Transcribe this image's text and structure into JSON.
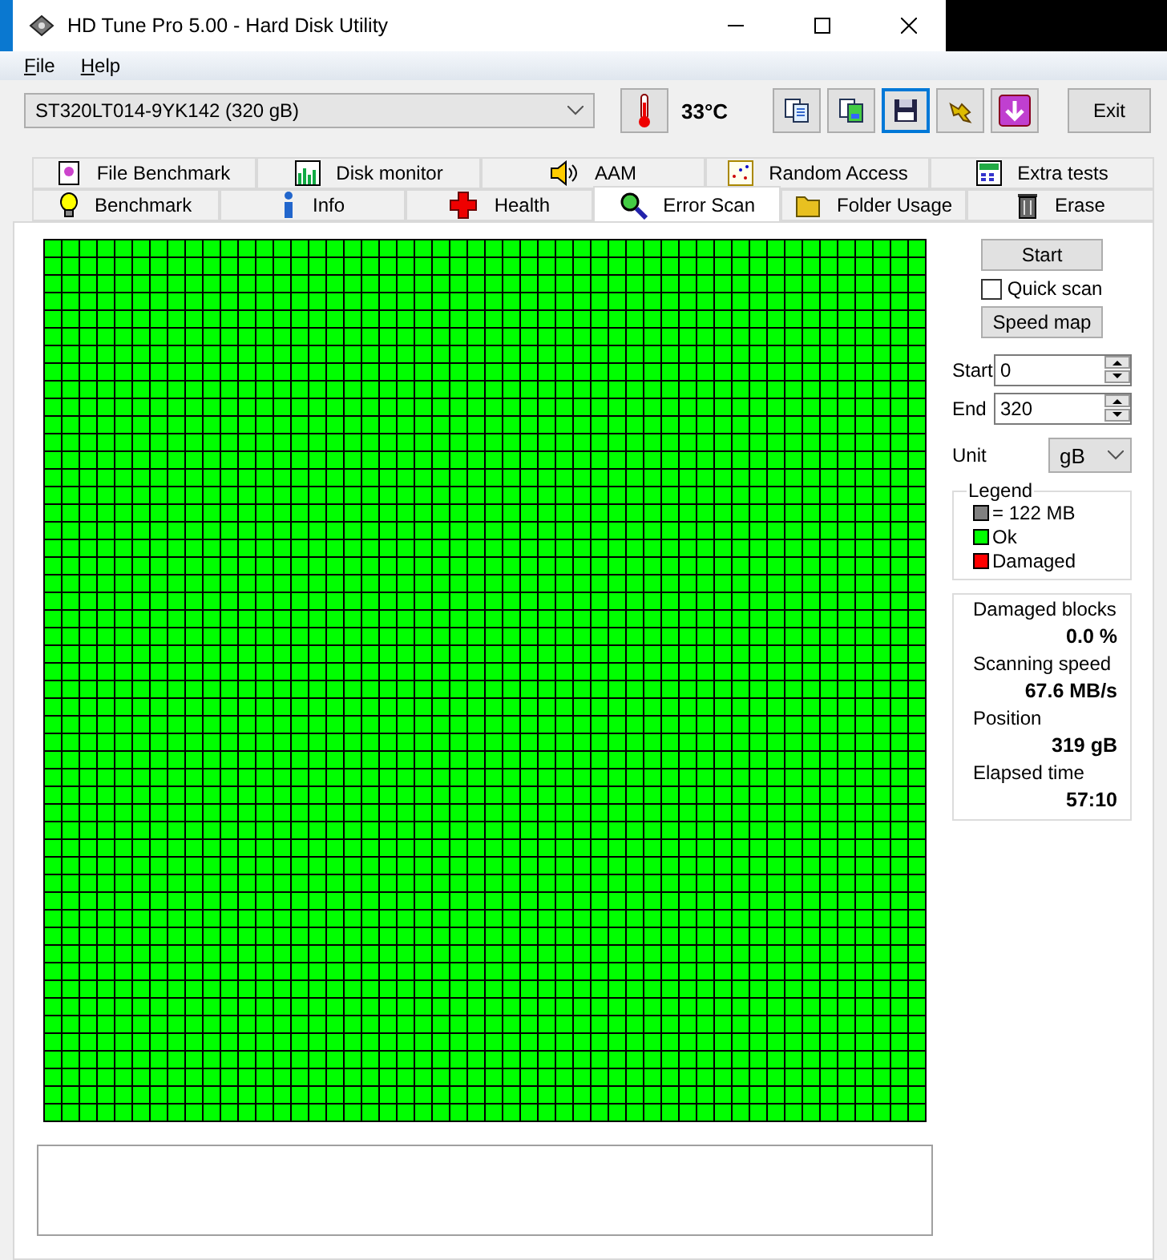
{
  "window": {
    "title": "HD Tune Pro 5.00 - Hard Disk Utility"
  },
  "menu": [
    {
      "label": "File"
    },
    {
      "label": "Help"
    }
  ],
  "drive": {
    "value": "ST320LT014-9YK142 (320 gB)"
  },
  "temperature": "33°C",
  "toolbar_buttons": [
    {
      "kind": "copy",
      "selected": false
    },
    {
      "kind": "compare",
      "selected": false
    },
    {
      "kind": "save",
      "selected": true
    },
    {
      "kind": "options",
      "selected": false
    },
    {
      "kind": "download",
      "selected": false
    }
  ],
  "exit_button": "Exit",
  "tab_rows": [
    {
      "tabs": [
        {
          "label": "File Benchmark",
          "kind": "file",
          "selected": false
        },
        {
          "label": "Disk monitor",
          "kind": "monitor",
          "selected": false
        },
        {
          "label": "AAM",
          "kind": "speaker",
          "selected": false
        },
        {
          "label": "Random Access",
          "kind": "random",
          "selected": false
        },
        {
          "label": "Extra tests",
          "kind": "extra",
          "selected": false
        }
      ]
    },
    {
      "tabs": [
        {
          "label": "Benchmark",
          "kind": "bulb",
          "selected": false
        },
        {
          "label": "Info",
          "kind": "info",
          "selected": false
        },
        {
          "label": "Health",
          "kind": "health",
          "selected": false
        },
        {
          "label": "Error Scan",
          "kind": "search",
          "selected": true
        },
        {
          "label": "Folder Usage",
          "kind": "folder",
          "selected": false
        },
        {
          "label": "Erase",
          "kind": "trash",
          "selected": false
        }
      ]
    }
  ],
  "start_button": "Start",
  "quick_scan": {
    "label": "Quick scan",
    "checked": false
  },
  "speed_map_button": "Speed map",
  "range": [
    {
      "label": "Start",
      "value": "0"
    },
    {
      "label": "End",
      "value": "320"
    }
  ],
  "unit": {
    "label": "Unit",
    "value": "gB"
  },
  "legend": {
    "title": "Legend",
    "items": [
      {
        "label": "= 122 MB",
        "color": "#808080"
      },
      {
        "label": "Ok",
        "color": "#00ff00"
      },
      {
        "label": "Damaged",
        "color": "#ff0000"
      }
    ]
  },
  "stats": [
    {
      "label": "Damaged blocks",
      "value": "0.0 %"
    },
    {
      "label": "Scanning speed",
      "value": "67.6 MB/s"
    },
    {
      "label": "Position",
      "value": "319 gB"
    },
    {
      "label": "Elapsed time",
      "value": "57:10"
    }
  ]
}
